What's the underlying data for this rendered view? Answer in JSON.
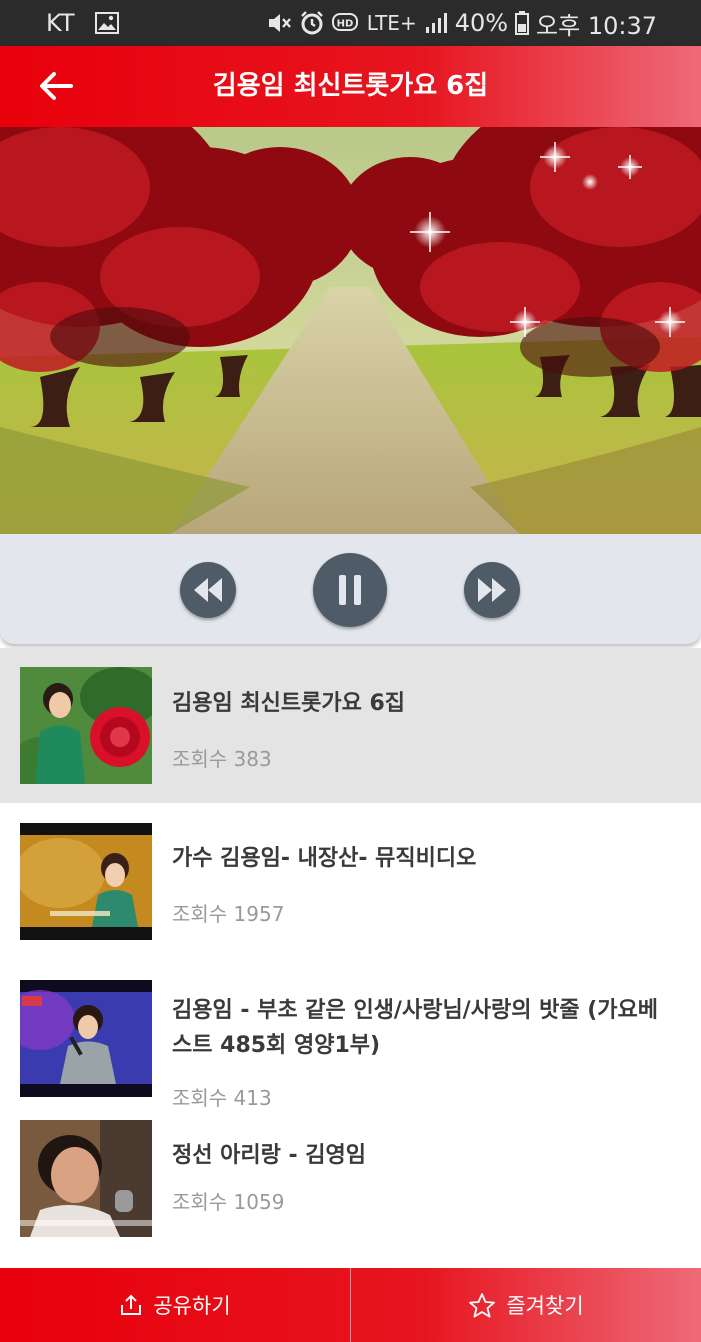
{
  "status_bar": {
    "carrier": "KT",
    "network": "LTE+",
    "battery": "40%",
    "time": "오후 10:37",
    "icons": [
      "image-icon",
      "mute-icon",
      "alarm-icon",
      "hd-icon",
      "signal-icon",
      "battery-icon"
    ]
  },
  "header": {
    "title": "김용임 최신트롯가요 6집",
    "back_icon": "arrow-left-icon"
  },
  "player": {
    "state": "playing",
    "controls": [
      "previous-button",
      "pause-button",
      "next-button"
    ]
  },
  "playlist": [
    {
      "title": "김용임 최신트롯가요 6집",
      "views": "조회수 383",
      "active": true
    },
    {
      "title": "가수 김용임- 내장산- 뮤직비디오",
      "views": "조회수 1957",
      "active": false
    },
    {
      "title": "김용임 - 부초 같은 인생/사랑님/사랑의 밧줄 (가요베스트 485회 영양1부)",
      "views": "조회수 413",
      "active": false
    },
    {
      "title": "정선 아리랑 - 김영임",
      "views": "조회수 1059",
      "active": false
    }
  ],
  "bottom_bar": {
    "share_label": "공유하기",
    "favorite_label": "즐겨찾기"
  },
  "colors": {
    "accent": "#e6151f",
    "accent_light": "#ee6a78",
    "player_bg": "#e3e7ed",
    "control": "#4f5c68"
  }
}
